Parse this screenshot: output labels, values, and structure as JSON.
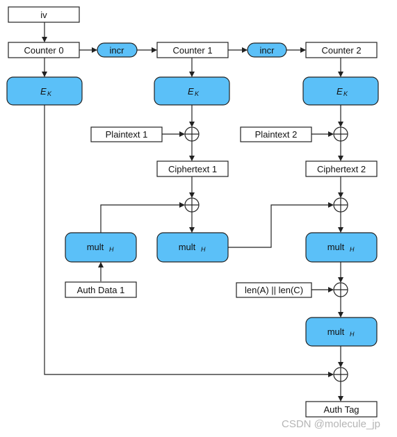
{
  "nodes": {
    "iv": "iv",
    "counter0": "Counter 0",
    "counter1": "Counter 1",
    "counter2": "Counter 2",
    "incr": "incr",
    "ek_main": "E",
    "ek_sub": "K",
    "plaintext1": "Plaintext 1",
    "plaintext2": "Plaintext 2",
    "ciphertext1": "Ciphertext 1",
    "ciphertext2": "Ciphertext 2",
    "mult_main": "mult",
    "mult_sub": "H",
    "auth_data1": "Auth Data 1",
    "len": "len(A) || len(C)",
    "auth_tag": "Auth Tag"
  },
  "watermark": "CSDN @molecule_jp",
  "colors": {
    "block": "#5bc0f8",
    "stroke": "#222222"
  }
}
